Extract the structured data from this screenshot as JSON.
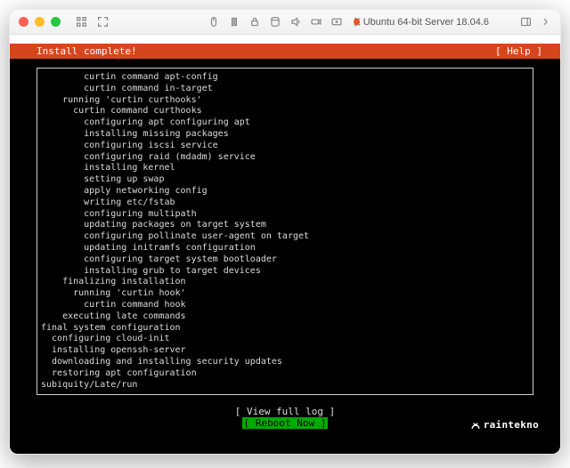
{
  "window": {
    "title": "Ubuntu 64-bit Server 18.04.6"
  },
  "header": {
    "title": "Install complete!",
    "help": "[ Help ]"
  },
  "log_lines": [
    "        curtin command apt-config",
    "        curtin command in-target",
    "    running 'curtin curthooks'",
    "      curtin command curthooks",
    "        configuring apt configuring apt",
    "        installing missing packages",
    "        configuring iscsi service",
    "        configuring raid (mdadm) service",
    "        installing kernel",
    "        setting up swap",
    "        apply networking config",
    "        writing etc/fstab",
    "        configuring multipath",
    "        updating packages on target system",
    "        configuring pollinate user-agent on target",
    "        updating initramfs configuration",
    "        configuring target system bootloader",
    "        installing grub to target devices",
    "    finalizing installation",
    "      running 'curtin hook'",
    "        curtin command hook",
    "    executing late commands",
    "final system configuration",
    "  configuring cloud-init",
    "  installing openssh-server",
    "  downloading and installing security updates",
    "  restoring apt configuration",
    "subiquity/Late/run"
  ],
  "footer": {
    "view_log": "[ View full log ]",
    "reboot": "[ Reboot Now    ]"
  },
  "watermark": "raintekno"
}
